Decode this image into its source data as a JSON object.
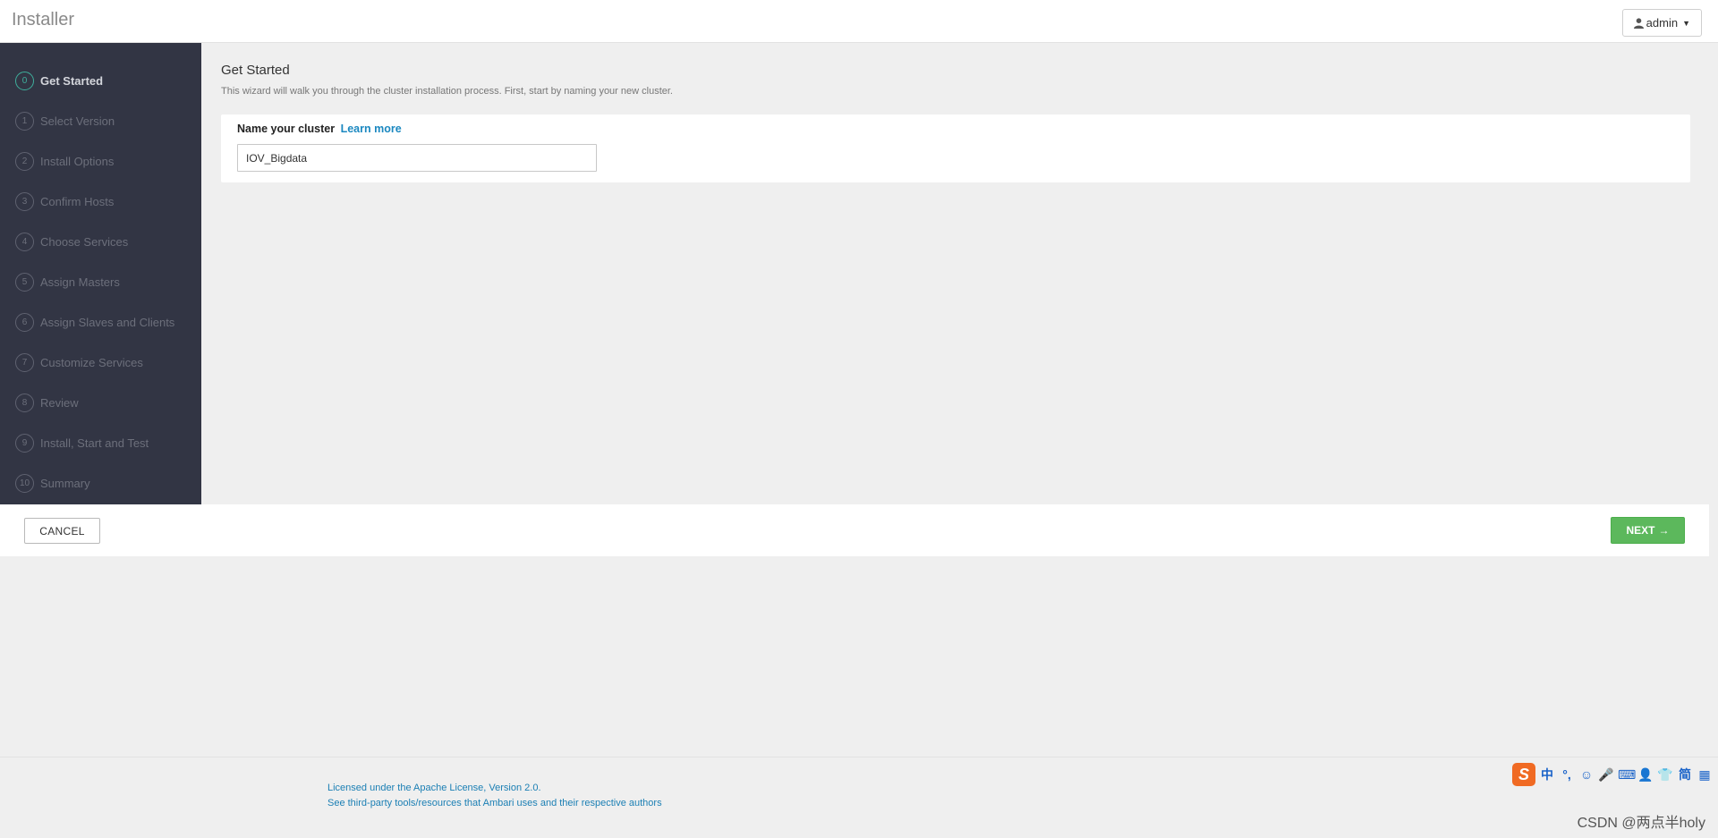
{
  "header": {
    "brand": "Installer",
    "user_label": "admin"
  },
  "sidebar": {
    "steps": [
      {
        "num": "0",
        "label": "Get Started",
        "active": true
      },
      {
        "num": "1",
        "label": "Select Version"
      },
      {
        "num": "2",
        "label": "Install Options"
      },
      {
        "num": "3",
        "label": "Confirm Hosts"
      },
      {
        "num": "4",
        "label": "Choose Services"
      },
      {
        "num": "5",
        "label": "Assign Masters"
      },
      {
        "num": "6",
        "label": "Assign Slaves and Clients"
      },
      {
        "num": "7",
        "label": "Customize Services"
      },
      {
        "num": "8",
        "label": "Review"
      },
      {
        "num": "9",
        "label": "Install, Start and Test"
      },
      {
        "num": "10",
        "label": "Summary"
      }
    ]
  },
  "main": {
    "title": "Get Started",
    "description": "This wizard will walk you through the cluster installation process. First, start by naming your new cluster.",
    "cluster_label": "Name your cluster",
    "learn_more": "Learn more",
    "cluster_name_value": "IOV_Bigdata"
  },
  "actions": {
    "cancel_label": "CANCEL",
    "next_label": "NEXT",
    "next_arrow": "→"
  },
  "footer": {
    "license": "Licensed under the Apache License, Version 2.0.",
    "third_party": "See third-party tools/resources that Ambari uses and their respective authors"
  },
  "ime_bar": {
    "logo": "S",
    "items": [
      "中",
      "°,",
      "☺",
      "🎤",
      "⌨",
      "👤",
      "👕",
      "简",
      "▦"
    ]
  },
  "watermark_credit": "CSDN @两点半holy",
  "colors": {
    "sidebar_bg": "#323544",
    "active_step": "#3fae9c",
    "next_button": "#5cb85c",
    "link": "#1b88c0"
  }
}
